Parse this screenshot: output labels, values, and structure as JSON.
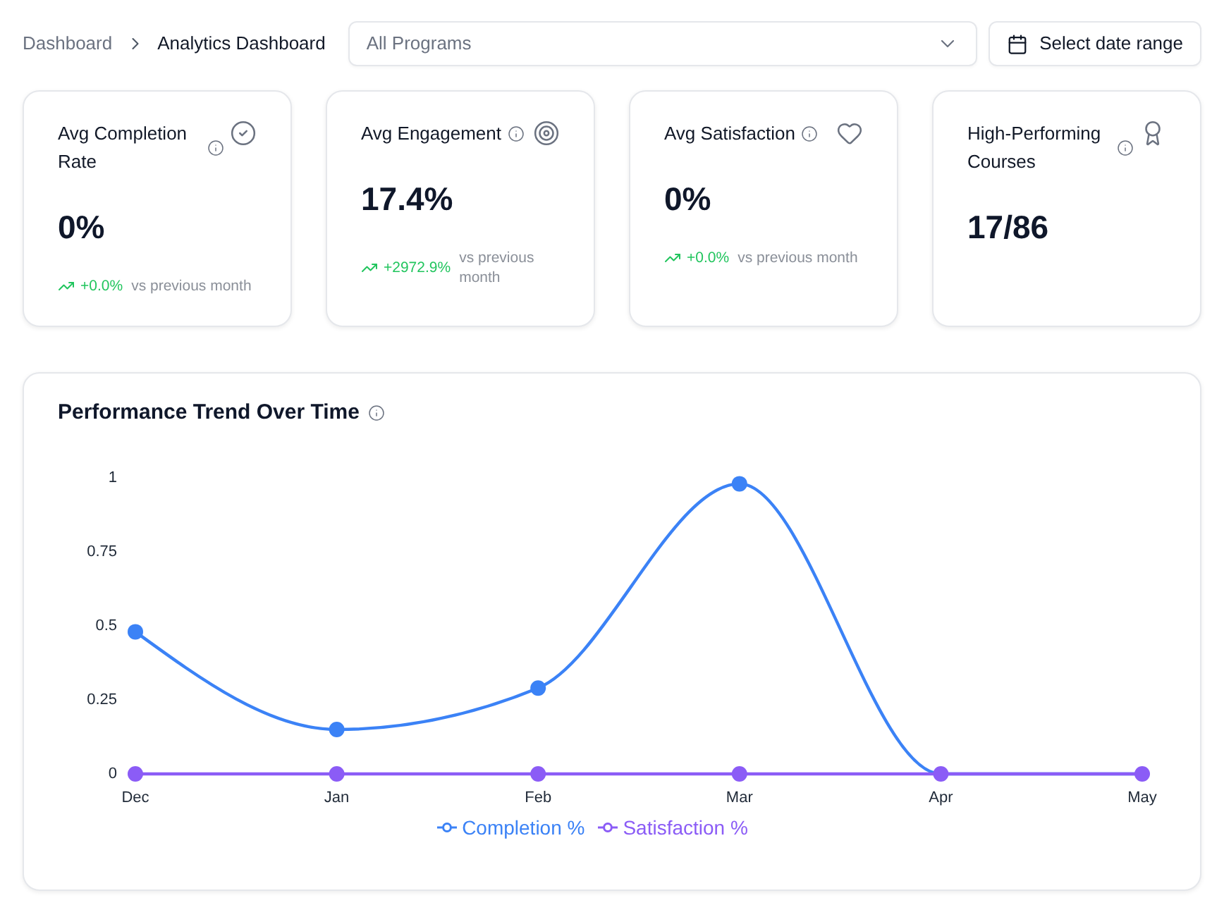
{
  "breadcrumb": [
    {
      "label": "Dashboard",
      "current": false
    },
    {
      "label": "Analytics Dashboard",
      "current": true
    }
  ],
  "program_filter": {
    "placeholder": "All Programs"
  },
  "date_button": {
    "label": "Select date range"
  },
  "metric_cards": [
    {
      "kind": "completion",
      "title": "Avg Completion Rate",
      "value": "0%",
      "trend": {
        "positive": true,
        "value": "+0.0%",
        "text": "vs previous month"
      }
    },
    {
      "kind": "engagement",
      "title": "Avg Engagement",
      "value": "17.4%",
      "trend": {
        "positive": true,
        "value": "+2972.9%",
        "text": "vs previous month"
      }
    },
    {
      "kind": "satisfaction",
      "title": "Avg Satisfaction",
      "value": "0%",
      "trend": {
        "positive": true,
        "value": "+0.0%",
        "text": "vs previous month"
      }
    },
    {
      "kind": "courses",
      "title": "High-Performing Courses",
      "value": "17/86"
    }
  ],
  "performance_chart": {
    "title": "Performance Trend Over Time",
    "chart_data": {
      "type": "line",
      "categories": [
        "Dec",
        "Jan",
        "Feb",
        "Mar",
        "Apr",
        "May"
      ],
      "series": [
        {
          "name": "Completion %",
          "color": "#3b82f6",
          "marker": "circle",
          "values": [
            0.48,
            0.15,
            0.29,
            0.98,
            0,
            0
          ]
        },
        {
          "name": "Satisfaction %",
          "color": "#8b5cf6",
          "marker": "circle",
          "values": [
            0,
            0,
            0,
            0,
            0,
            0
          ]
        }
      ],
      "ylim": [
        0,
        1
      ],
      "yticks": [
        0,
        0.25,
        0.5,
        0.75,
        1
      ],
      "legend": "bottom"
    }
  }
}
